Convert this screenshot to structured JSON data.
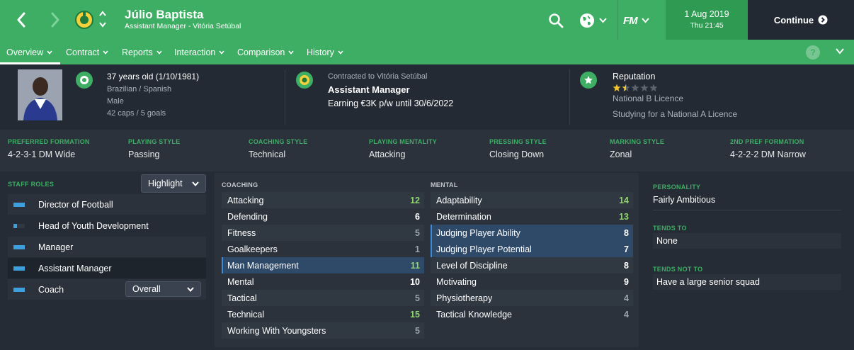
{
  "header": {
    "name": "Júlio Baptista",
    "subtitle": "Assistant Manager - Vitória Setúbal",
    "date": "1 Aug 2019",
    "time": "Thu 21:45",
    "continue_label": "Continue",
    "fm_logo": "FM",
    "icons": [
      "back-arrow-icon",
      "forward-arrow-icon",
      "club-crest-icon",
      "up-down-chevron-icon",
      "search-icon",
      "globe-icon",
      "chevron-down-icon",
      "continue-arrow-icon"
    ]
  },
  "tabs": [
    {
      "label": "Overview",
      "active": true
    },
    {
      "label": "Contract"
    },
    {
      "label": "Reports"
    },
    {
      "label": "Interaction"
    },
    {
      "label": "Comparison"
    },
    {
      "label": "History"
    }
  ],
  "tabbar": {
    "help_label": "?"
  },
  "info": {
    "age": "37 years old (1/10/1981)",
    "nationality": "Brazilian / Spanish",
    "gender": "Male",
    "caps": "42 caps / 5 goals",
    "contract_label": "Contracted to Vitória Setúbal",
    "job": "Assistant Manager",
    "earning": "Earning €3K p/w until 30/6/2022",
    "reputation_label": "Reputation",
    "reputation_stars": 1.5,
    "reputation_max": 5,
    "licence": "National B Licence",
    "studying": "Studying for a National A Licence"
  },
  "tactics": [
    {
      "head": "PREFERRED FORMATION",
      "value": "4-2-3-1 DM Wide"
    },
    {
      "head": "PLAYING STYLE",
      "value": "Passing"
    },
    {
      "head": "COACHING STYLE",
      "value": "Technical"
    },
    {
      "head": "PLAYING MENTALITY",
      "value": "Attacking"
    },
    {
      "head": "PRESSING STYLE",
      "value": "Closing Down"
    },
    {
      "head": "MARKING STYLE",
      "value": "Zonal"
    },
    {
      "head": "2ND PREF FORMATION",
      "value": "4-2-2-2 DM Narrow"
    }
  ],
  "staff_roles": {
    "title": "STAFF ROLES",
    "dropdown": "Highlight",
    "coach_dropdown": "Overall",
    "roles": [
      {
        "label": "Director of Football",
        "level": 1.0
      },
      {
        "label": "Head of Youth Development",
        "level": 0.3
      },
      {
        "label": "Manager",
        "level": 1.0
      },
      {
        "label": "Assistant Manager",
        "level": 1.0
      },
      {
        "label": "Coach",
        "level": 1.0
      }
    ]
  },
  "coaching": {
    "title": "COACHING",
    "attrs": [
      {
        "label": "Attacking",
        "value": "12",
        "tone": "g"
      },
      {
        "label": "Defending",
        "value": "6",
        "tone": "w"
      },
      {
        "label": "Fitness",
        "value": "5",
        "tone": "d"
      },
      {
        "label": "Goalkeepers",
        "value": "1",
        "tone": "d"
      },
      {
        "label": "Man Management",
        "value": "11",
        "tone": "g",
        "hi": true
      },
      {
        "label": "Mental",
        "value": "10",
        "tone": "w"
      },
      {
        "label": "Tactical",
        "value": "5",
        "tone": "d"
      },
      {
        "label": "Technical",
        "value": "15",
        "tone": "g"
      },
      {
        "label": "Working With Youngsters",
        "value": "5",
        "tone": "d"
      }
    ]
  },
  "mental": {
    "title": "MENTAL",
    "attrs": [
      {
        "label": "Adaptability",
        "value": "14",
        "tone": "g"
      },
      {
        "label": "Determination",
        "value": "13",
        "tone": "g"
      },
      {
        "label": "Judging Player Ability",
        "value": "8",
        "tone": "w",
        "hi": true
      },
      {
        "label": "Judging Player Potential",
        "value": "7",
        "tone": "w",
        "hi": true
      },
      {
        "label": "Level of Discipline",
        "value": "8",
        "tone": "w"
      },
      {
        "label": "Motivating",
        "value": "9",
        "tone": "w"
      },
      {
        "label": "Physiotherapy",
        "value": "4",
        "tone": "d"
      },
      {
        "label": "Tactical Knowledge",
        "value": "4",
        "tone": "d"
      }
    ]
  },
  "personality": {
    "title": "PERSONALITY",
    "value": "Fairly Ambitious",
    "tends_to_title": "TENDS TO",
    "tends_to": "None",
    "tends_not_title": "TENDS NOT TO",
    "tends_not": "Have a large senior squad"
  },
  "colors": {
    "brand": "#3dae63",
    "highlight": "#2f4a68",
    "good": "#8fd56c",
    "role_bar": "#3f9fdd"
  }
}
